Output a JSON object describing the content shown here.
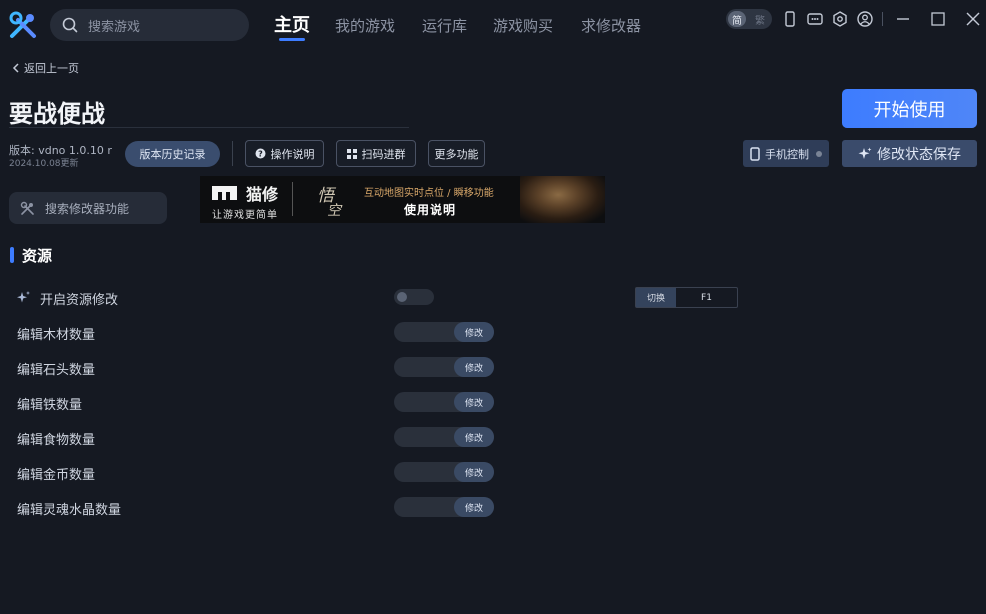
{
  "topbar": {
    "search_placeholder": "搜索游戏",
    "nav": [
      "主页",
      "我的游戏",
      "运行库",
      "游戏购买",
      "求修改器"
    ],
    "lang_on": "简",
    "lang_off": "繁"
  },
  "back_label": "返回上一页",
  "game_title": "要战便战",
  "start_button": "开始使用",
  "version_text": "版本: vdno 1.0.10 r",
  "version_date": "2024.10.08更新",
  "buttons": {
    "history": "版本历史记录",
    "guide": "操作说明",
    "scan": "扫码进群",
    "more": "更多功能",
    "phone": "手机控制",
    "save_state": "修改状态保存"
  },
  "search_function_placeholder": "搜索修改器功能",
  "banner": {
    "brand": "猫修",
    "brand_sub": "让游戏更简单",
    "calligraphy_1": "悟",
    "calligraphy_2": "空",
    "line1": "互动地图实时点位 / 瞬移功能",
    "line2": "使用说明"
  },
  "section_title": "资源",
  "toggle_row": {
    "label": "开启资源修改",
    "hotkey_action": "切换",
    "hotkey_key": "F1"
  },
  "edit_button_label": "修改",
  "edit_rows": [
    "编辑木材数量",
    "编辑石头数量",
    "编辑铁数量",
    "编辑食物数量",
    "编辑金币数量",
    "编辑灵魂水晶数量"
  ]
}
